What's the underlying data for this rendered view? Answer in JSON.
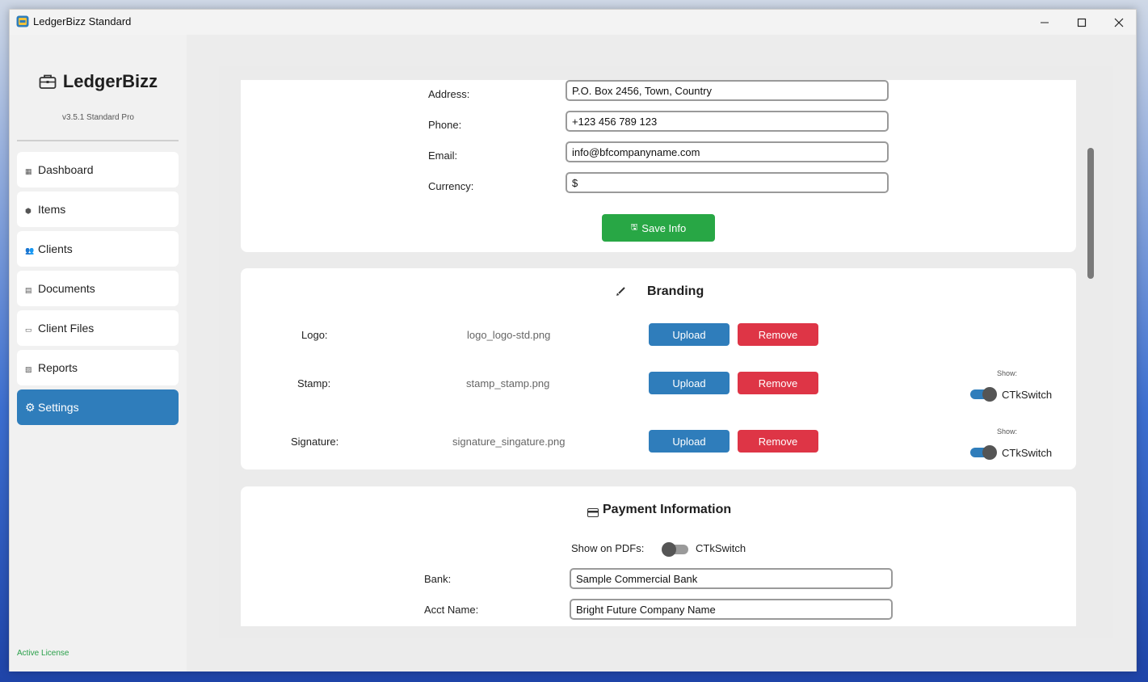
{
  "window": {
    "title": "LedgerBizz Standard"
  },
  "sidebar": {
    "brand": "LedgerBizz",
    "version": "v3.5.1 Standard Pro",
    "items": [
      {
        "label": "Dashboard"
      },
      {
        "label": "Items"
      },
      {
        "label": "Clients"
      },
      {
        "label": "Documents"
      },
      {
        "label": "Client Files"
      },
      {
        "label": "Reports"
      },
      {
        "label": "Settings"
      }
    ],
    "active_item": "Settings",
    "license": "Active License"
  },
  "company_info": {
    "address_label": "Address:",
    "address_value": "P.O. Box 2456, Town, Country",
    "phone_label": "Phone:",
    "phone_value": "+123 456 789 123",
    "email_label": "Email:",
    "email_value": "info@bfcompanyname.com",
    "currency_label": "Currency:",
    "currency_value": "$",
    "save_label": "Save Info"
  },
  "branding": {
    "title": "Branding",
    "upload_label": "Upload",
    "remove_label": "Remove",
    "show_label": "Show:",
    "switch_text": "CTkSwitch",
    "rows": [
      {
        "label": "Logo:",
        "file": "logo_logo-std.png"
      },
      {
        "label": "Stamp:",
        "file": "stamp_stamp.png",
        "show": true
      },
      {
        "label": "Signature:",
        "file": "signature_singature.png",
        "show": true
      }
    ]
  },
  "payment": {
    "title": "Payment Information",
    "show_pdfs_label": "Show on PDFs:",
    "switch_text": "CTkSwitch",
    "show_on_pdfs": false,
    "bank_label": "Bank:",
    "bank_value": "Sample Commercial Bank",
    "acct_name_label": "Acct Name:",
    "acct_name_value": "Bright Future Company Name"
  },
  "colors": {
    "accent": "#2f7dbb",
    "danger": "#de3546",
    "success": "#28a745",
    "license": "#2aa04a"
  }
}
